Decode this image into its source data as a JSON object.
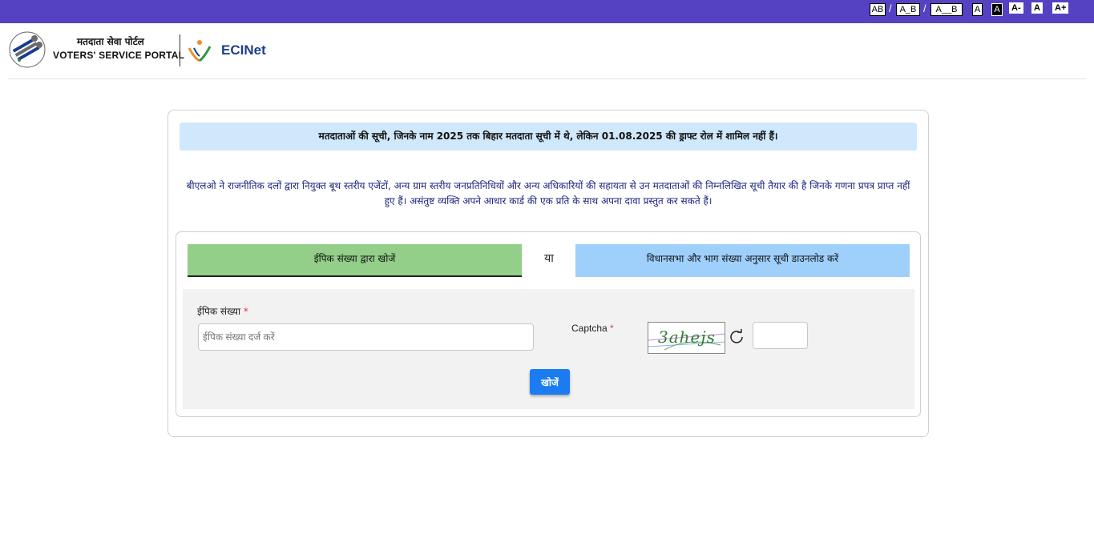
{
  "accessibility_bar": {
    "spacing_buttons": [
      "AB",
      "A_B",
      "A__B"
    ],
    "separator": "/",
    "contrast_normal": "A",
    "contrast_dark": "A",
    "font_decrease": "A-",
    "font_normal": "A",
    "font_increase": "A+"
  },
  "header": {
    "portal_name_hindi": "मतदाता सेवा पोर्टल",
    "portal_name_english": "VOTERS' SERVICE PORTAL",
    "ecinet_label": "ECINet"
  },
  "notice": {
    "heading": "मतदाताओं की सूची, जिनके नाम 2025 तक बिहार मतदाता सूची में थे, लेकिन 01.08.2025 की ड्राफ्ट रोल में शामिल नहीं हैं।",
    "description": "बीएलओ ने राजनीतिक दलों द्वारा नियुक्त बूथ स्तरीय एजेंटों, अन्य ग्राम स्तरीय जनप्रतिनिधियों और अन्य अधिकारियों की सहायता से उन मतदाताओं की निम्नलिखित सूची तैयार की है जिनके गणना प्रपत्र प्राप्त नहीं हुए हैं। असंतुष्ट व्यक्ति अपने आधार कार्ड की एक प्रति के साथ अपना दावा प्रस्तुत कर सकते हैं।"
  },
  "tabs": {
    "search_by_epic": "ईपिक संख्या द्वारा खोजें",
    "or": "या",
    "download_by_ac": "विधानसभा और भाग संख्या अनुसार सूची डाउनलोड करें"
  },
  "form": {
    "epic_label": "ईपिक संख्या",
    "required_mark": "*",
    "epic_placeholder": "ईपिक संख्या दर्ज करें",
    "captcha_label": "Captcha",
    "captcha_text": "3ahejs",
    "captcha_value": "",
    "search_button": "खोजें"
  },
  "colors": {
    "top_bar": "#5442c2",
    "notice_bg": "#cfe8fb",
    "epic_tab": "#93cf89",
    "ac_tab": "#9ed0fb",
    "button": "#1a7cf0",
    "description_text": "#1a237e"
  }
}
